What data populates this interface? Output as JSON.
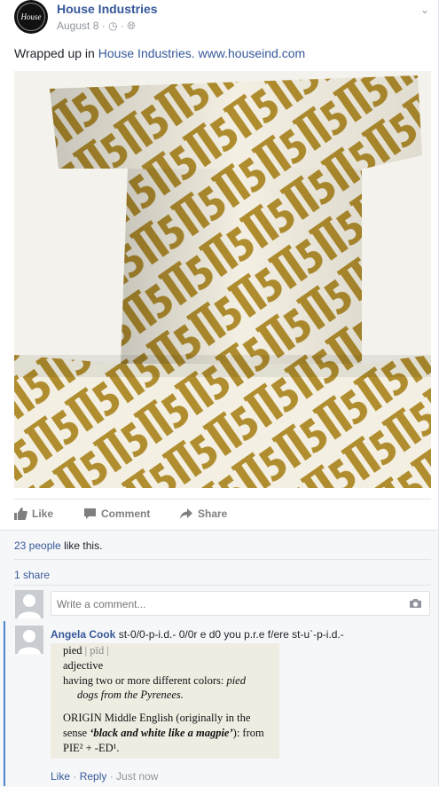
{
  "post": {
    "page_name": "House Industries",
    "avatar_text": "House",
    "date": "August 8",
    "dot": "·",
    "text_prefix": "Wrapped up in",
    "text_link": "House Industries.",
    "text_url": "www.houseind.com",
    "photo_desc_icon": "gift-boxes-photo"
  },
  "actions": {
    "like": "Like",
    "comment": "Comment",
    "share": "Share"
  },
  "ufi": {
    "likes_count": "23 people",
    "likes_suffix": "like this.",
    "shares": "1 share",
    "compose_placeholder": "Write a comment..."
  },
  "comment": {
    "author": "Angela Cook",
    "text": "st-0/0-p-i.d.- 0/0r e d0 you p.r.e f/ere st-u`-p-i.d.-",
    "like": "Like",
    "reply": "Reply",
    "time": "Just now",
    "attachment": {
      "line1": "pied",
      "line1b": "| pīd |",
      "line2": "adjective",
      "line3a": "having two or more different colors:",
      "line3b": "pied",
      "line4": "dogs from the Pyrenees.",
      "line5": "ORIGIN Middle English (originally in the",
      "line6a": "sense",
      "line6b": "‘black and white like a magpie’",
      "line6c": "): from",
      "line7": "PIE² + -ED¹."
    }
  },
  "colors": {
    "link": "#365899",
    "gold": "#b08d2e",
    "accent_bar": "#4b88cb"
  }
}
